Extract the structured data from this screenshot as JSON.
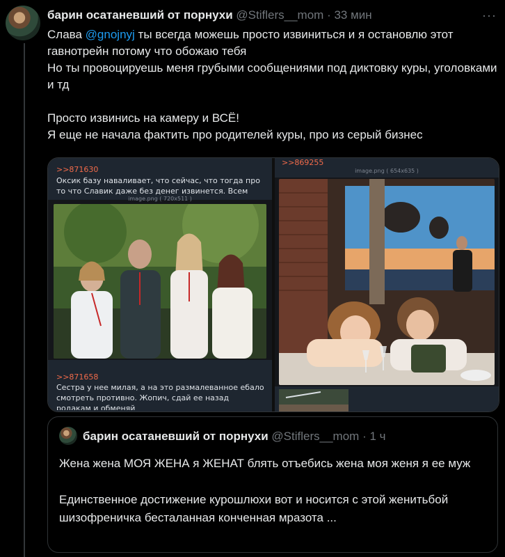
{
  "tweet": {
    "display_name": "барин осатаневший от порнухи",
    "handle": "@Stiflers__mom",
    "separator": "·",
    "time": "33 мин",
    "more_label": "···",
    "text_before_mention": "Слава ",
    "mention": "@gnojnyj",
    "text_after_mention": " ты всегда можешь просто извиниться и я остановлю этот гавнотрейн потому что обожаю тебя\nНо ты провоцируешь меня грубыми сообщениями под диктовку куры, уголовками и тд\n\nПросто извинись на камеру и ВСЁ!\nЯ еще не начала фактить про родителей куры, про из серый бизнес"
  },
  "media": {
    "left": {
      "post1_id": ">>871630",
      "post1_text": "Оксик базу наваливает, что сейчас, что тогда про то что Славик даже без денег извинется. Всем",
      "image1_meta": "image.png ( 720x511 )",
      "post2_id": ">>871658",
      "post2_text": "Сестра у нее милая, а на это размалеванное ебало смотреть противно. Жопич, сдай ее назад родакам и обменяй"
    },
    "right": {
      "post_id": ">>869255",
      "image_meta": "image.png ( 654x635 )"
    }
  },
  "quote": {
    "display_name": "барин осатаневший от порнухи",
    "handle": "@Stiflers__mom",
    "separator": "·",
    "time": "1 ч",
    "text": "Жена жена МОЯ ЖЕНА я ЖЕНАТ блять отъебись жена моя женя я ее муж\n\nЕдинственное достижение курошлюхи вот и носится с этой женитьбой шизофреничка бесталанная конченная мразота ..."
  },
  "colors": {
    "background": "#000000",
    "text": "#e7e9ea",
    "secondary": "#71767b",
    "link": "#1d9bf0",
    "border": "#2f3336",
    "imageboard_id": "#f26b4a"
  }
}
